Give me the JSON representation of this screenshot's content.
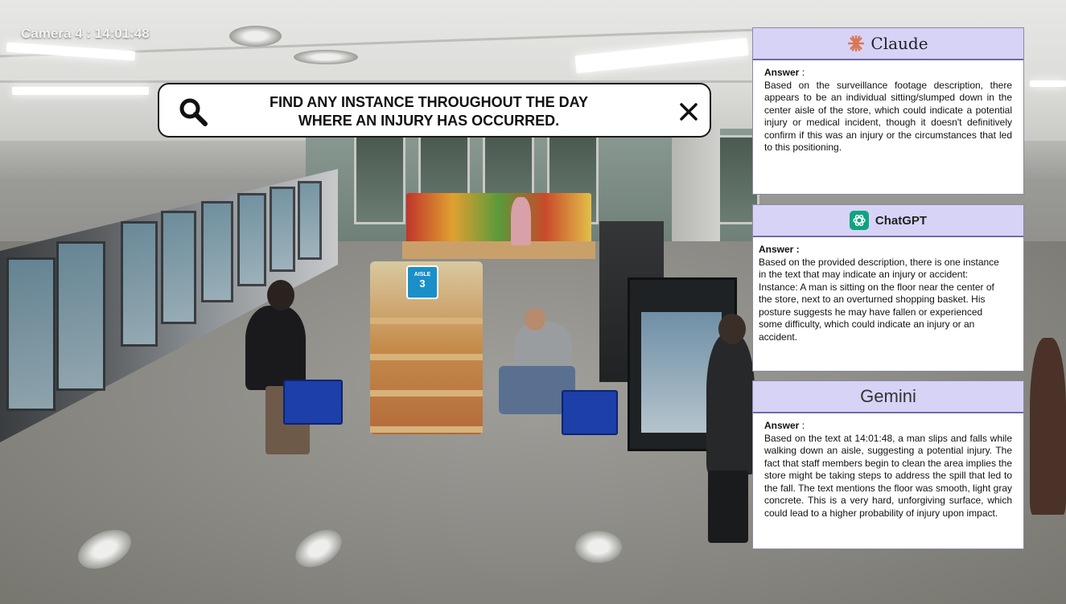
{
  "camera": {
    "label": "Camera 4 : 14:01:48"
  },
  "search": {
    "line1": "FIND ANY INSTANCE THROUGHOUT THE DAY",
    "line2": "WHERE AN INJURY HAS OCCURRED.",
    "icon": "search-icon",
    "close_icon": "close-icon"
  },
  "panels": {
    "claude": {
      "title": "Claude",
      "answer_label": "Answer",
      "answer_sep": " :",
      "text": "Based on the surveillance footage description, there appears to be an individual sitting/slumped down in the center aisle of the store, which could indicate a potential injury or medical incident, though it doesn't definitively confirm if this was an injury or the circumstances that led to this positioning.",
      "accent": "#d97757"
    },
    "chatgpt": {
      "title": "ChatGPT",
      "answer_label": "Answer :",
      "text1": "Based on the provided description, there is one instance in the text that may indicate an injury or accident:",
      "text2": "Instance: A man is sitting on the floor near the center of the store, next to an overturned shopping basket. His posture suggests he may have fallen or experienced some difficulty, which could indicate an injury or an accident.",
      "accent": "#10a37f"
    },
    "gemini": {
      "title": "Gemini",
      "answer_label": "Answer",
      "answer_sep": " :",
      "text": "Based on the text at 14:01:48, a man slips and falls while walking down an aisle, suggesting a potential injury. The fact that staff members begin to clean the area implies the store might be taking steps to address the spill that led to the fall. The text mentions the floor was smooth, light gray concrete. This is a very hard, unforgiving surface, which could lead to a higher probability of injury upon impact."
    },
    "header_color": "#d7d3f7"
  },
  "scene": {
    "aisle_sign": "AISLE",
    "aisle_number": "3"
  }
}
